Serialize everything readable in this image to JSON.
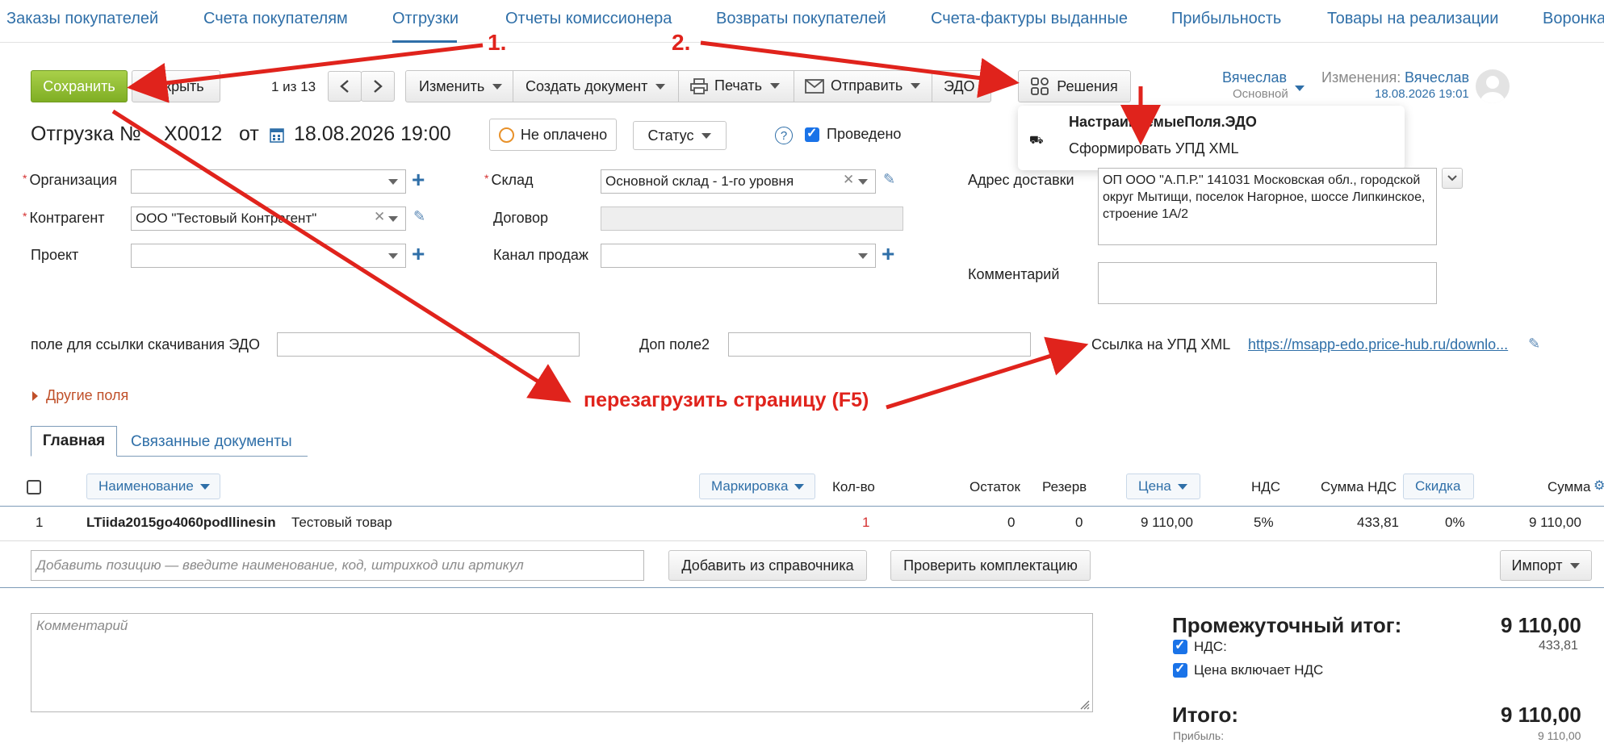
{
  "nav": {
    "items": [
      "Заказы покупателей",
      "Счета покупателям",
      "Отгрузки",
      "Отчеты комиссионера",
      "Возвраты покупателей",
      "Счета-фактуры выданные",
      "Прибыльность",
      "Товары на реализации",
      "Воронка"
    ],
    "active_index": 2
  },
  "toolbar": {
    "save": "Сохранить",
    "close": "Закрыть",
    "pager": "1 из 13",
    "edit": "Изменить",
    "create_document": "Создать документ",
    "print": "Печать",
    "send": "Отправить",
    "edo": "ЭДО",
    "solutions": "Решения"
  },
  "user": {
    "name": "Вячеслав",
    "role": "Основной",
    "changes_label": "Изменения:",
    "changes_user": "Вячеслав",
    "changes_time": "18.08.2026 19:01"
  },
  "solutions_menu": {
    "title": "НастраиваемыеПоля.ЭДО",
    "item": "Сформировать УПД XML"
  },
  "doc": {
    "title": "Отгрузка №",
    "number": "X0012",
    "from": "от",
    "date": "18.08.2026 19:00",
    "payment_status": "Не оплачено",
    "status_button": "Статус",
    "help": "?",
    "posted_label": "Проведено"
  },
  "form": {
    "organization_label": "Организация",
    "organization_value": "",
    "counterparty_label": "Контрагент",
    "counterparty_value": "ООО \"Тестовый Контрагент\"",
    "project_label": "Проект",
    "project_value": "",
    "warehouse_label": "Склад",
    "warehouse_value": "Основной склад - 1-го уровня",
    "contract_label": "Договор",
    "sales_channel_label": "Канал продаж",
    "delivery_address_label": "Адрес доставки",
    "delivery_address_value": "ОП ООО \"А.П.Р.\" 141031 Московская обл., городской округ Мытищи, поселок Нагорное, шоссе Липкинское, строение 1А/2",
    "comment_label": "Комментарий",
    "edo_link_field_label": "поле для ссылки скачивания ЭДО",
    "extra_field2_label": "Доп поле2",
    "upd_link_label": "Ссылка на УПД XML",
    "upd_link_value": "https://msapp-edo.price-hub.ru/downlo...",
    "other_fields": "Другие поля"
  },
  "tabs": {
    "main": "Главная",
    "related": "Связанные документы"
  },
  "table": {
    "headers": {
      "name": "Наименование",
      "marking": "Маркировка",
      "qty": "Кол-во",
      "stock": "Остаток",
      "reserve": "Резерв",
      "price": "Цена",
      "vat": "НДС",
      "vat_sum": "Сумма НДС",
      "discount": "Скидка",
      "sum": "Сумма"
    },
    "rows": [
      {
        "index": "1",
        "code": "LTiida2015go4060podllinesin",
        "name": "Тестовый товар",
        "qty": "1",
        "stock": "0",
        "reserve": "0",
        "price": "9 110,00",
        "vat": "5%",
        "vat_sum": "433,81",
        "discount": "0%",
        "sum": "9 110,00"
      }
    ]
  },
  "add_row": {
    "placeholder": "Добавить позицию — введите наименование, код, штрихкод или артикул",
    "add_from_catalog": "Добавить из справочника",
    "check_kit": "Проверить комплектацию",
    "import": "Импорт"
  },
  "footer": {
    "comment_placeholder": "Комментарий",
    "subtotal_label": "Промежуточный итог:",
    "subtotal_value": "9 110,00",
    "vat_label": "НДС:",
    "vat_value": "433,81",
    "price_includes_vat": "Цена включает НДС",
    "total_label": "Итого:",
    "total_value": "9 110,00",
    "profit_label": "Прибыль:",
    "profit_value": "9 110,00"
  },
  "annotations": {
    "step1": "1.",
    "step2": "2.",
    "reload": "перезагрузить страницу (F5)",
    "color": "#e0231c"
  }
}
